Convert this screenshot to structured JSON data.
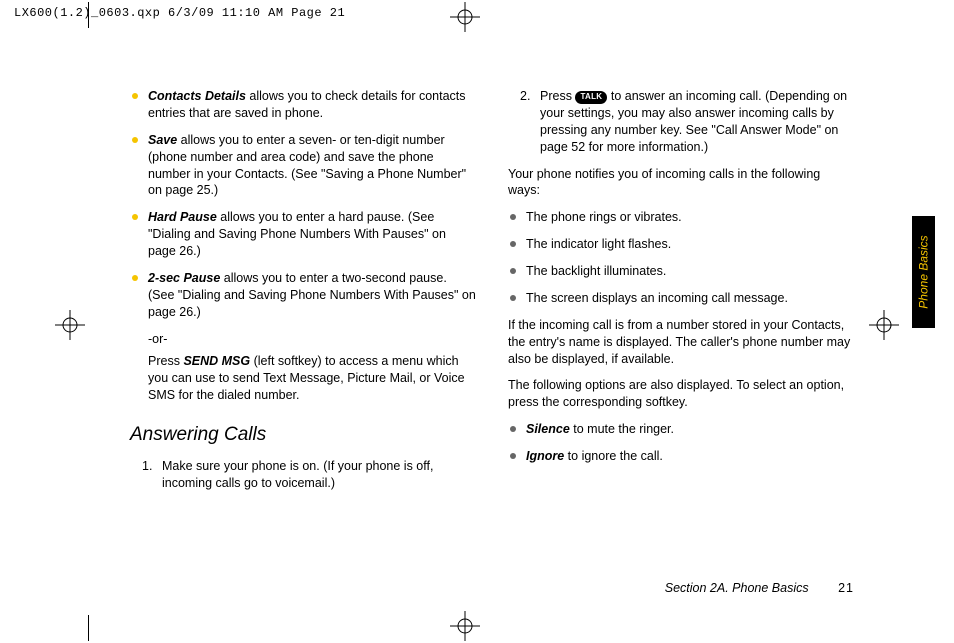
{
  "slug": "LX600(1.2)_0603.qxp  6/3/09  11:10 AM  Page 21",
  "side_tab": "Phone Basics",
  "footer": {
    "section": "Section 2A. Phone Basics",
    "page": "21"
  },
  "left": {
    "bullets": [
      {
        "lead": "Contacts Details",
        "rest": " allows you to check details for contacts entries that are saved in phone."
      },
      {
        "lead": "Save",
        "rest": " allows you to enter a seven- or ten-digit number (phone number and area code) and save the phone number in your Contacts. (See \"Saving a Phone Number\" on page 25.)"
      },
      {
        "lead": "Hard Pause",
        "rest": " allows you to enter a hard pause. (See \"Dialing and Saving Phone Numbers With Pauses\" on page 26.)"
      },
      {
        "lead": "2-sec Pause",
        "rest": " allows you to enter a two-second pause. (See \"Dialing and Saving Phone Numbers With Pauses\" on page 26.)"
      }
    ],
    "or": "-or-",
    "press_lead": "Press ",
    "press_softkey": "SEND MSG",
    "press_rest": " (left softkey) to access a menu which you can use to send Text Message, Picture Mail, or Voice SMS for the dialed number.",
    "heading": "Answering Calls",
    "step1_num": "1.",
    "step1": "Make sure your phone is on. (If your phone is off, incoming calls go to voicemail.)"
  },
  "right": {
    "step2_num": "2.",
    "step2_a": "Press ",
    "talk_label": "TALK",
    "step2_b": " to answer an incoming call. (Depending on your settings, you may also answer incoming calls by  pressing any number key. See \"Call Answer Mode\" on page 52  for more information.)",
    "p1": "Your phone notifies you of incoming calls in the following ways:",
    "notify": [
      "The phone rings or vibrates.",
      "The indicator light flashes.",
      "The backlight illuminates.",
      "The screen displays an incoming call message."
    ],
    "p2": "If the incoming call is from a number stored in your Contacts, the entry's name is displayed. The caller's phone number may also be displayed, if available.",
    "p3": "The following options are also displayed. To select an option, press the corresponding softkey.",
    "options": [
      {
        "lead": "Silence",
        "rest": " to mute the ringer."
      },
      {
        "lead": "Ignore",
        "rest": " to ignore the call."
      }
    ]
  }
}
